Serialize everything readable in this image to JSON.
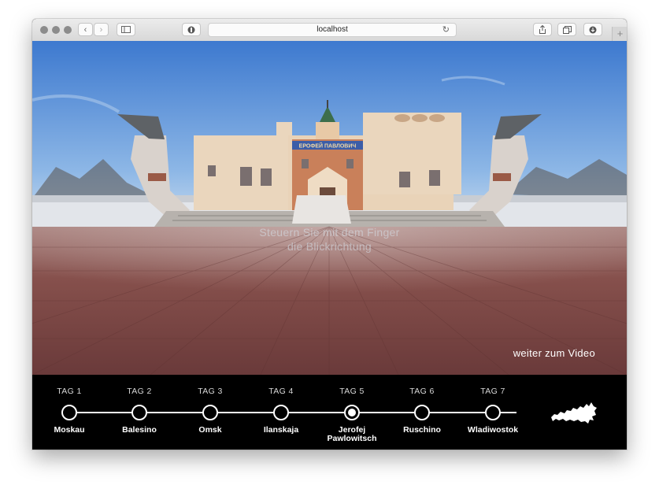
{
  "browser": {
    "url": "localhost",
    "icons": [
      "back-icon",
      "forward-icon",
      "sidebar-icon",
      "shield-icon",
      "reload-icon",
      "share-icon",
      "tabs-icon",
      "download-icon",
      "new-tab-icon"
    ]
  },
  "scene": {
    "building_sign": "ЕРОФЕЙ ПАВЛОВИЧ",
    "hint_line1": "Steuern Sie mit dem Finger",
    "hint_line2": "die Blickrichtung",
    "next_link": "weiter zum Video"
  },
  "timeline": {
    "days": [
      {
        "tag": "TAG 1",
        "city": "Moskau",
        "active": false
      },
      {
        "tag": "TAG 2",
        "city": "Balesino",
        "active": false
      },
      {
        "tag": "TAG 3",
        "city": "Omsk",
        "active": false
      },
      {
        "tag": "TAG 4",
        "city": "Ilanskaja",
        "active": false
      },
      {
        "tag": "TAG 5",
        "city": "Jerofej",
        "city2": "Pawlowitsch",
        "active": true
      },
      {
        "tag": "TAG 6",
        "city": "Ruschino",
        "active": false
      },
      {
        "tag": "TAG 7",
        "city": "Wladiwostok",
        "active": false
      }
    ]
  },
  "colors": {
    "sky": "#5b92d6",
    "plaza": "#7a4a48",
    "timeline_bg": "#000000",
    "accent": "#ffffff"
  }
}
